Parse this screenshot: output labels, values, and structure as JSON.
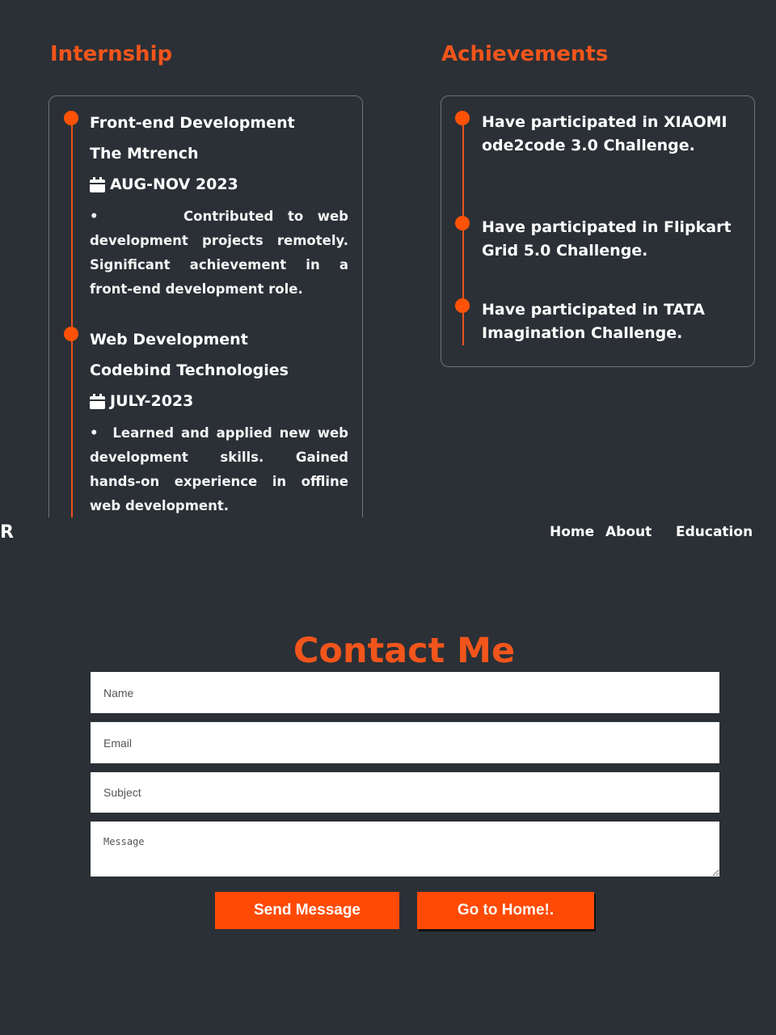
{
  "internship": {
    "title": "Internship",
    "items": [
      {
        "role": "Front-end Development",
        "company": "The Mtrench",
        "date": "AUG-NOV 2023",
        "description": "•      Contributed to web development projects remotely. Significant achievement in a front-end development role."
      },
      {
        "role": "Web Development",
        "company": "Codebind Technologies",
        "date": "JULY-2023",
        "description": "•  Learned and applied new web development skills. Gained hands-on experience in offline web development."
      }
    ]
  },
  "achievements": {
    "title": "Achievements",
    "items": [
      "Have participated in XIAOMI ode2code 3.0 Challenge.",
      "Have participated in Flipkart Grid 5.0 Challenge.",
      "Have participated in TATA Imagination Challenge."
    ]
  },
  "nav": {
    "logo_fragment": "R",
    "links": [
      "Home",
      "About",
      "Education"
    ]
  },
  "contact": {
    "title": "Contact Me",
    "placeholders": {
      "name": "Name",
      "email": "Email",
      "subject": "Subject",
      "message": "Message"
    },
    "send_label": "Send Message",
    "home_label": "Go to Home!."
  },
  "colors": {
    "background": "#2b3036",
    "accent": "#f2551c",
    "button": "#ff4a05"
  }
}
